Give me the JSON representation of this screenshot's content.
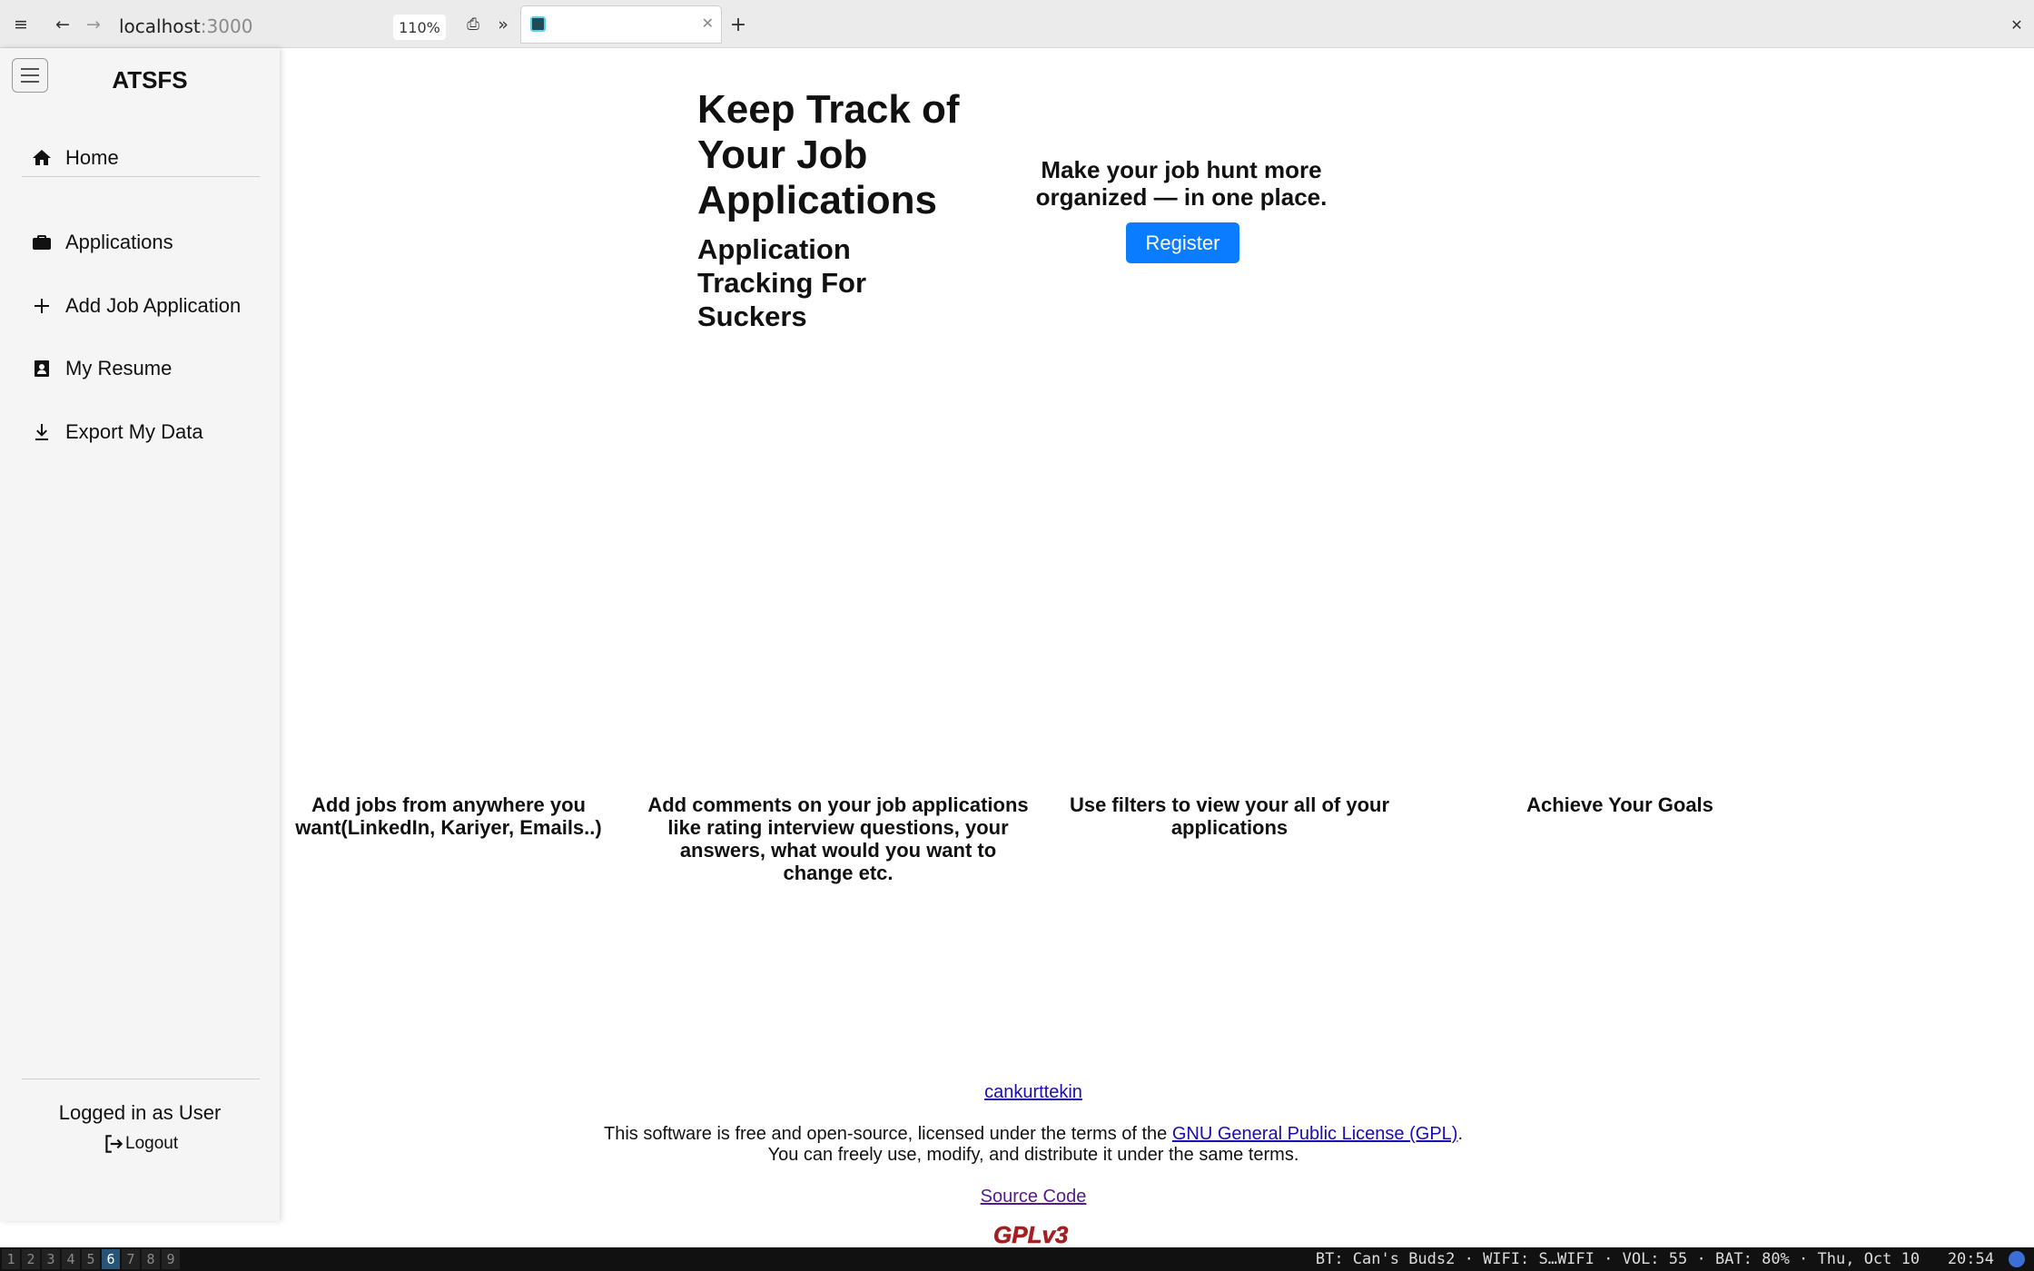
{
  "browser": {
    "url_host": "localhost",
    "url_port": ":3000",
    "zoom": "110%",
    "tab_title": ""
  },
  "sidebar": {
    "brand": "ATSFS",
    "items": [
      {
        "label": "Home",
        "icon": "home-icon"
      },
      {
        "label": "Applications",
        "icon": "briefcase-icon"
      },
      {
        "label": "Add Job Application",
        "icon": "plus-icon"
      },
      {
        "label": "My Resume",
        "icon": "resume-icon"
      },
      {
        "label": "Export My Data",
        "icon": "download-icon"
      }
    ],
    "logged_in": "Logged in as User",
    "logout": "Logout"
  },
  "hero": {
    "title": "Keep Track of Your Job Applications",
    "subtitle": "Application Tracking For Suckers",
    "tagline": "Make your job hunt more organized — in one place.",
    "register": "Register"
  },
  "features": [
    {
      "text": "Add jobs from anywhere you want(LinkedIn, Kariyer, Emails..)",
      "icon": "file-drawer-icon"
    },
    {
      "text": "Add comments on your job applications like rating interview questions, your answers, what would you want to change etc.",
      "icon": "star-rating-icon"
    },
    {
      "text": "Use filters to view your all of your applications",
      "icon": "magnifier-icon"
    },
    {
      "text": "Achieve Your Goals",
      "icon": "target-icon"
    }
  ],
  "footer": {
    "author": "cankurttekin",
    "license_prefix": "This software is free and open-source, licensed under the terms of the ",
    "license_link": "GNU General Public License (GPL)",
    "license_suffix": ".",
    "license_line2": "You can freely use, modify, and distribute it under the same terms.",
    "source": "Source Code",
    "badge": "GPLv3"
  },
  "statusbar": {
    "workspaces": [
      "1",
      "2",
      "3",
      "4",
      "5",
      "6",
      "7",
      "8",
      "9"
    ],
    "active_workspace": "6",
    "text": "BT: Can's Buds2 · WIFI: S…WIFI · VOL: 55 · BAT: 80% · Thu, Oct 10   20:54"
  }
}
